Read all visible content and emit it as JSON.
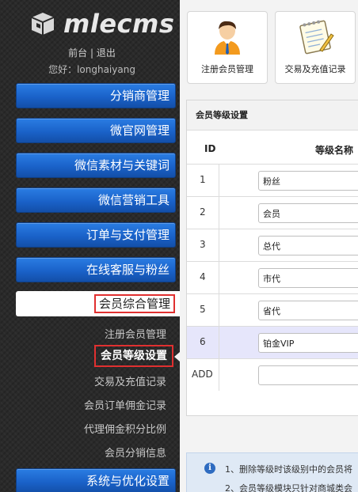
{
  "brand": {
    "name": "mlecms"
  },
  "top_links": {
    "front": "前台",
    "sep": "|",
    "logout": "退出"
  },
  "greeting": "您好：longhaiyang",
  "menu": [
    "分销商管理",
    "微官网管理",
    "微信素材与关键词",
    "微信营销工具",
    "订单与支付管理",
    "在线客服与粉丝"
  ],
  "active_menu": "会员综合管理",
  "submenu": {
    "register": "注册会员管理",
    "level": "会员等级设置",
    "trade": "交易及充值记录",
    "order_commission": "会员订单佣金记录",
    "agent_ratio": "代理佣金积分比例",
    "distribution": "会员分销信息"
  },
  "bottom_menu": "系统与优化设置",
  "tiles": [
    {
      "label": "注册会员管理",
      "icon": "user-manager-icon"
    },
    {
      "label": "交易及充值记录",
      "icon": "notepad-icon"
    }
  ],
  "panel": {
    "title": "会员等级设置",
    "col_id": "ID",
    "col_name": "等级名称",
    "rows": [
      {
        "id": "1",
        "name": "粉丝"
      },
      {
        "id": "2",
        "name": "会员"
      },
      {
        "id": "3",
        "name": "总代"
      },
      {
        "id": "4",
        "name": "市代"
      },
      {
        "id": "5",
        "name": "省代"
      },
      {
        "id": "6",
        "name": "铂金VIP"
      }
    ],
    "add_label": "ADD",
    "add_value": ""
  },
  "notice": {
    "line1": "1、删除等级时该级别中的会员将",
    "line2": "2、会员等级模块只针对商城类会"
  }
}
